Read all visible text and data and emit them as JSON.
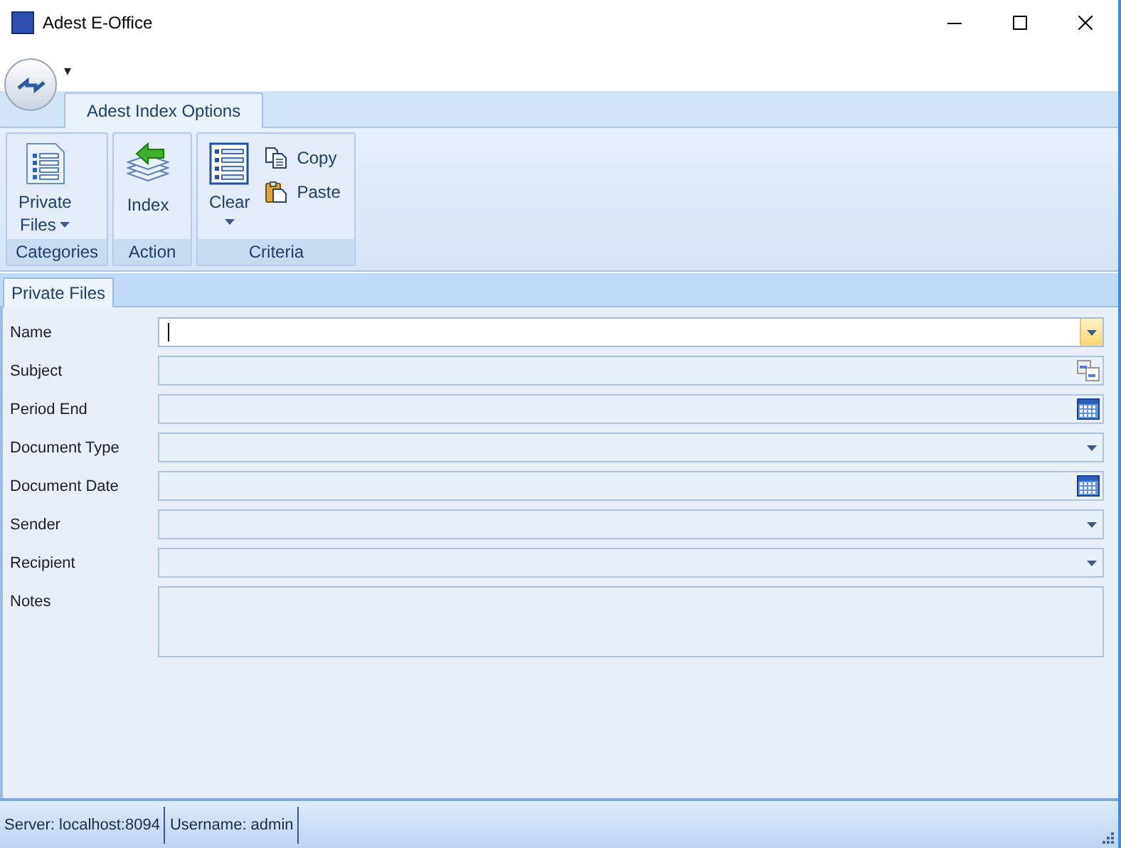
{
  "window": {
    "title": "Adest E-Office"
  },
  "quick_access": {
    "menu_glyph": "▾"
  },
  "ribbon_tabs": [
    {
      "label": "Adest Index Options",
      "selected": true
    }
  ],
  "ribbon_groups": [
    {
      "label": "Categories",
      "buttons": [
        {
          "kind": "large",
          "label": "Private",
          "label2": "Files",
          "dropdown": true
        }
      ]
    },
    {
      "label": "Action",
      "buttons": [
        {
          "kind": "large",
          "label": "Index"
        }
      ]
    },
    {
      "label": "Criteria",
      "buttons": [
        {
          "kind": "large",
          "label": "Clear",
          "dropdown": true
        },
        {
          "kind": "small",
          "label": "Copy"
        },
        {
          "kind": "small",
          "label": "Paste"
        }
      ]
    }
  ],
  "document_tabs": [
    {
      "label": "Private Files",
      "selected": true
    }
  ],
  "fields": [
    {
      "label": "Name",
      "kind": "dropdown",
      "focused": true
    },
    {
      "label": "Subject",
      "kind": "lookup",
      "focused": false
    },
    {
      "label": "Period End",
      "kind": "date",
      "focused": false
    },
    {
      "label": "Document Type",
      "kind": "dropdown",
      "focused": false
    },
    {
      "label": "Document Date",
      "kind": "date",
      "focused": false
    },
    {
      "label": "Sender",
      "kind": "dropdown",
      "focused": false
    },
    {
      "label": "Recipient",
      "kind": "dropdown",
      "focused": false
    },
    {
      "label": "Notes",
      "kind": "multiline",
      "focused": false
    }
  ],
  "status_bar": [
    "Server: localhost:8094",
    "Username: admin"
  ]
}
